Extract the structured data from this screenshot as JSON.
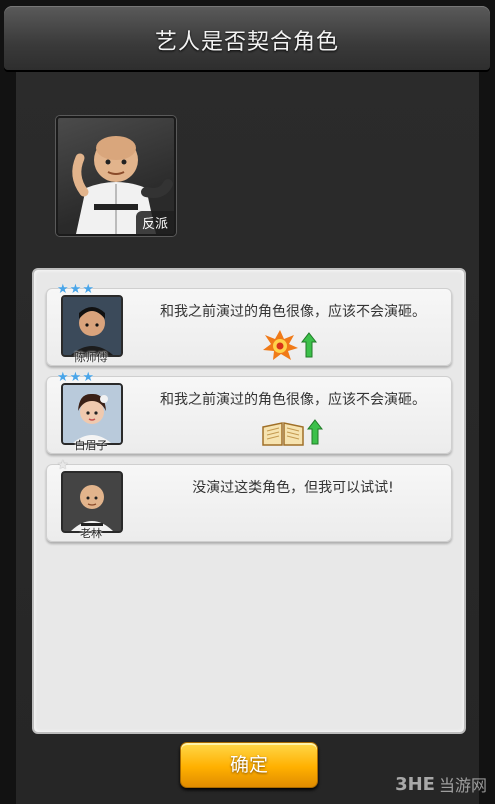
{
  "header": {
    "title": "艺人是否契合角色"
  },
  "role": {
    "tag": "反派",
    "icon": "bald-kungfu-portrait"
  },
  "actors": [
    {
      "name": "陈师傅",
      "stars": 3,
      "max_stars": 3,
      "quote": "和我之前演过的角色很像，应该不会演砸。",
      "bonus_icon": "explosion-icon",
      "trend_icon": "arrow-up-icon",
      "star_color": "#4aa5e8"
    },
    {
      "name": "白眉子",
      "stars": 3,
      "max_stars": 3,
      "quote": "和我之前演过的角色很像，应该不会演砸。",
      "bonus_icon": "book-icon",
      "trend_icon": "arrow-up-icon",
      "star_color": "#4aa5e8"
    },
    {
      "name": "老林",
      "stars": 0,
      "max_stars": 1,
      "quote": "没演过这类角色，但我可以试试!",
      "star_color": "#4aa5e8"
    }
  ],
  "confirm_label": "确定",
  "watermark": {
    "logo": "3HE",
    "text": "当游网"
  },
  "colors": {
    "button": "#ffb000",
    "arrow": "#3cc04a",
    "panel": "#e8e8e8"
  }
}
